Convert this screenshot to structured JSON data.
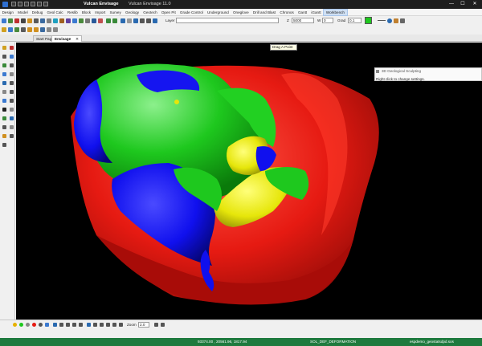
{
  "window": {
    "app_tab_title": "Vulcan Envisage",
    "window_title": "Vulcan Envisage 11.0",
    "controls": {
      "minimize": "—",
      "maximize": "☐",
      "close": "✕"
    }
  },
  "menu": [
    "Design",
    "Model",
    "Debug",
    "Geol Calc",
    "Reslib",
    "Block",
    "Import",
    "Survey",
    "Geology",
    "Geotech",
    "Open Pit",
    "Grade Control",
    "Underground",
    "Oneglove",
    "Drill and Blast",
    "Chronos",
    "Gantt",
    "iGantt",
    "Workbench"
  ],
  "menu_active": "Workbench",
  "toolbar": {
    "layer_label": "Layer",
    "layer_value": "",
    "z_label": "Z",
    "z_value": "5000",
    "w_label": "W",
    "w_value": "0",
    "grad_label": "Grad",
    "grad_value": "0.1",
    "color_swatch": "#1ec81e"
  },
  "tabs": [
    {
      "label": "Start Page",
      "close": "✕"
    },
    {
      "label": "Envisage",
      "close": "✕"
    }
  ],
  "viewport": {
    "tooltip": "Drag A Point",
    "panel_title": "3D Geological Sculpting",
    "panel_body": "Right click to change settings."
  },
  "bottom_toolbar": {
    "zoom_label": "Zoom",
    "zoom_value": "2.0"
  },
  "statusbar": {
    "coords": "93374.00 , 20561.96, 1817.94",
    "layer": "SOL_DEF_DEFORMATION",
    "file": "espdemo_geostatsdpd.sos"
  },
  "colors": {
    "surface_red": "#e61a12",
    "surface_green": "#1ec81e",
    "surface_blue": "#1010ee",
    "surface_yellow": "#e6e60a",
    "status_green": "#1e7a3e"
  }
}
